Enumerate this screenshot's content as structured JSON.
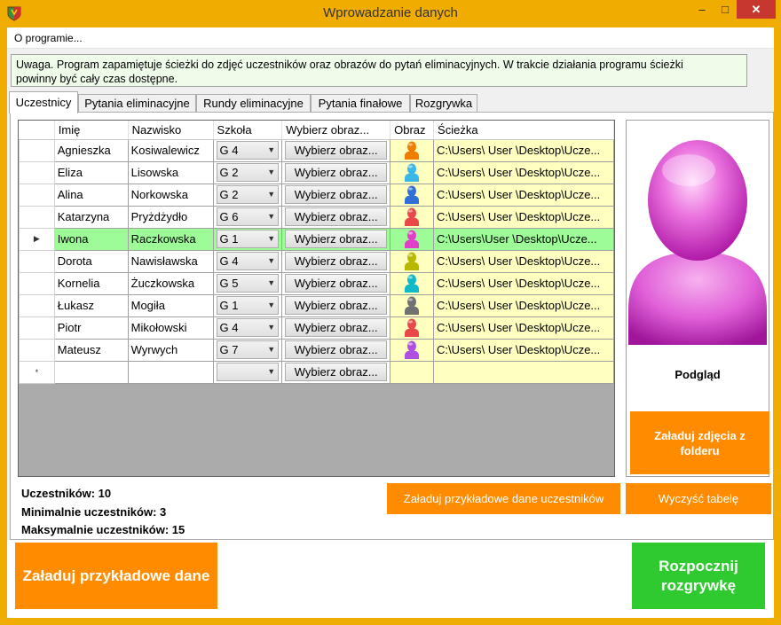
{
  "window": {
    "title": "Wprowadzanie danych",
    "controls": {
      "minimize": "–",
      "maximize": "□",
      "close": "✕"
    }
  },
  "menu": {
    "about": "O programie..."
  },
  "notice": {
    "line1": "Uwaga. Program zapamiętuje ścieżki do zdjęć uczestników oraz obrazów do pytań eliminacyjnych. W trakcie działania programu ścieżki",
    "line2": "powinny być cały czas dostępne."
  },
  "tabs": [
    "Uczestnicy",
    "Pytania eliminacyjne",
    "Rundy eliminacyjne",
    "Pytania finałowe",
    "Rozgrywka"
  ],
  "grid": {
    "columns": {
      "first_name": "Imię",
      "last_name": "Nazwisko",
      "school": "Szkoła",
      "choose_image": "Wybierz obraz...",
      "image": "Obraz",
      "path": "Ścieżka"
    },
    "button_label": "Wybierz obraz...",
    "rows": [
      {
        "first_name": "Agnieszka",
        "last_name": "Kosiwalewicz",
        "school": "G 4",
        "path": "C:\\Users\\ User \\Desktop\\Ucze...",
        "color": "#f07c00"
      },
      {
        "first_name": "Eliza",
        "last_name": "Lisowska",
        "school": "G 2",
        "path": "C:\\Users\\ User \\Desktop\\Ucze...",
        "color": "#3cb8e8"
      },
      {
        "first_name": "Alina",
        "last_name": "Norkowska",
        "school": "G 2",
        "path": "C:\\Users\\ User \\Desktop\\Ucze...",
        "color": "#2f6fd6"
      },
      {
        "first_name": "Katarzyna",
        "last_name": "Pryżdżydło",
        "school": "G 6",
        "path": "C:\\Users\\ User \\Desktop\\Ucze...",
        "color": "#e84848"
      },
      {
        "first_name": "Iwona",
        "last_name": "Raczkowska",
        "school": "G 1",
        "path": "C:\\Users\\User \\Desktop\\Ucze...",
        "color": "#e040c8"
      },
      {
        "first_name": "Dorota",
        "last_name": "Nawisławska",
        "school": "G 4",
        "path": "C:\\Users\\ User \\Desktop\\Ucze...",
        "color": "#b8b800"
      },
      {
        "first_name": "Kornelia",
        "last_name": "Żuczkowska",
        "school": "G 5",
        "path": "C:\\Users\\ User \\Desktop\\Ucze...",
        "color": "#10b8c8"
      },
      {
        "first_name": "Łukasz",
        "last_name": "Mogiła",
        "school": "G 1",
        "path": "C:\\Users\\ User \\Desktop\\Ucze...",
        "color": "#707070"
      },
      {
        "first_name": "Piotr",
        "last_name": "Mikołowski",
        "school": "G 4",
        "path": "C:\\Users\\ User \\Desktop\\Ucze...",
        "color": "#e84848"
      },
      {
        "first_name": "Mateusz",
        "last_name": "Wyrwych",
        "school": "G 7",
        "path": "C:\\Users\\ User \\Desktop\\Ucze...",
        "color": "#b050e0"
      }
    ],
    "selected_row_index": 4,
    "current_row_marker": "▶",
    "new_row_marker": "*"
  },
  "preview": {
    "label": "Podgląd",
    "color": "#e060d8"
  },
  "buttons": {
    "load_photos_folder": "Załaduj zdjęcia z folderu",
    "load_sample_participants": "Załaduj przykładowe dane uczestników",
    "clear_table": "Wyczyść tabelę",
    "load_sample_data": "Załaduj przykładowe dane",
    "start_game": "Rozpocznij rozgrywkę"
  },
  "stats": {
    "participants": "Uczestników: 10",
    "min_participants": "Minimalnie uczestników:  3",
    "max_participants": "Maksymalnie uczestników: 15"
  },
  "colors": {
    "titlebar": "#f0ad00",
    "orange": "#ff8c00",
    "green": "#2fca2f",
    "selected_row": "#9dfc97",
    "image_cell": "#ffffc0"
  }
}
